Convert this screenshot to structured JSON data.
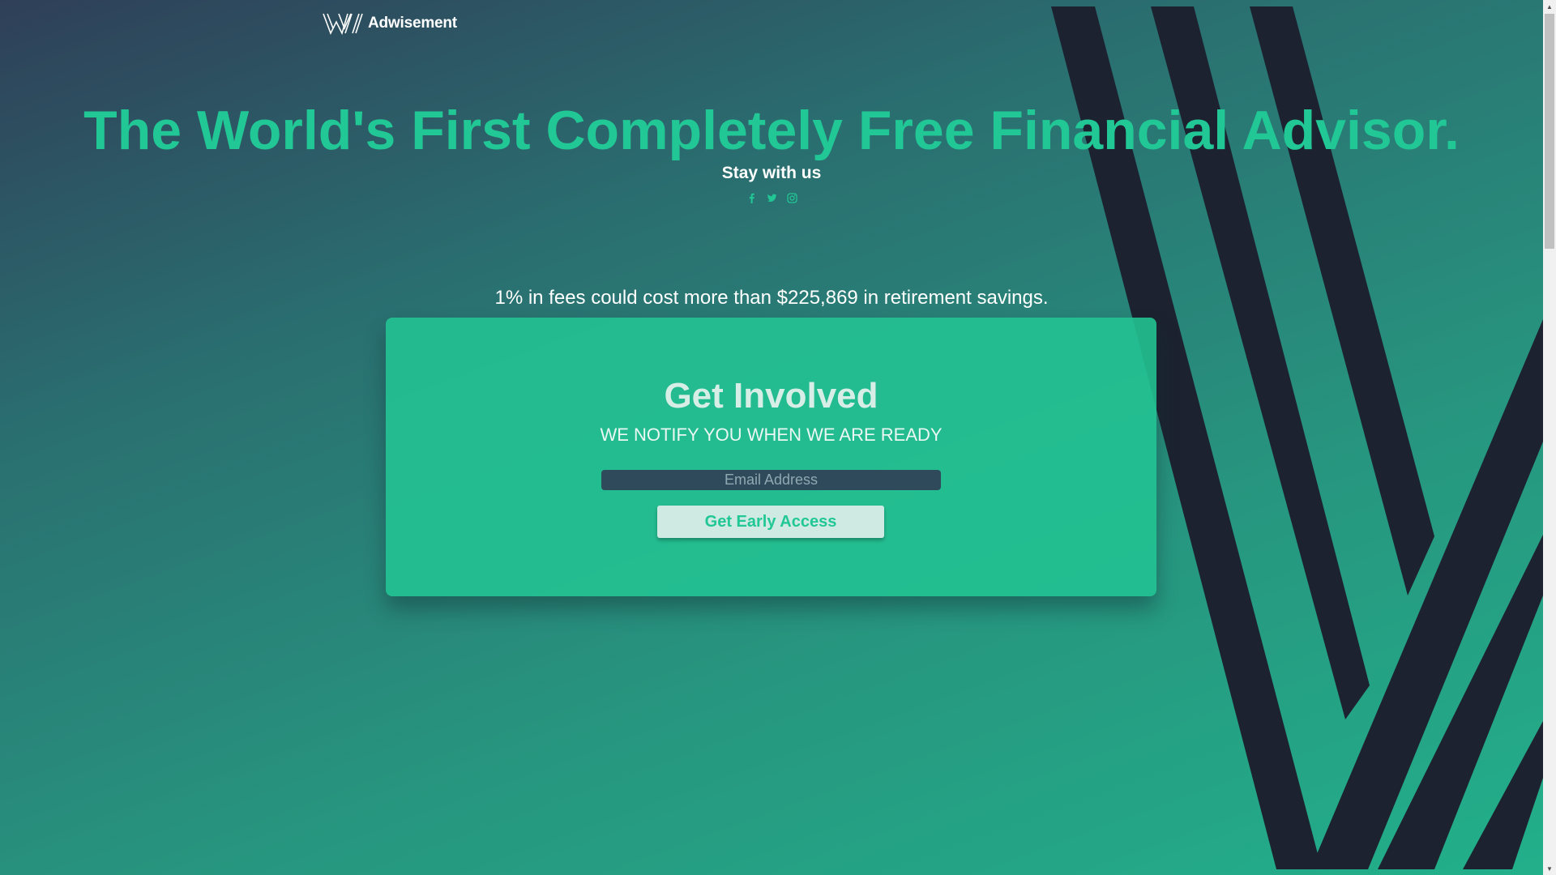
{
  "header": {
    "brand": "Adwisement",
    "logo_icon": "adwisement-logo-icon"
  },
  "hero": {
    "title": "The World's First Completely Free Financial Advisor.",
    "stay_label": "Stay with us",
    "social": [
      {
        "icon": "facebook-icon",
        "glyph": "f"
      },
      {
        "icon": "twitter-icon",
        "glyph": "bird"
      },
      {
        "icon": "instagram-icon",
        "glyph": "camera"
      }
    ]
  },
  "fees_text": "1% in fees could cost more than $225,869 in retirement savings.",
  "card": {
    "title": "Get Involved",
    "subtitle": "WE NOTIFY YOU WHEN WE ARE READY",
    "email_placeholder": "Email Address",
    "email_value": "",
    "cta_label": "Get Early Access"
  },
  "scrollbar": {
    "up_glyph": "▲",
    "down_glyph": "▼"
  },
  "colors": {
    "accent": "#21c795",
    "stripe_dark": "#1c2230",
    "card_bg": "#22c292",
    "input_bg": "#2f4b5b",
    "button_bg": "#cfeae3"
  }
}
